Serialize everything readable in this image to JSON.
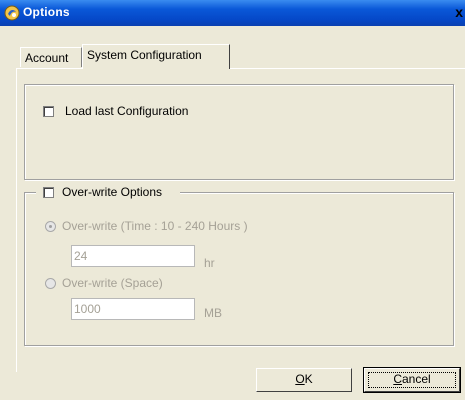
{
  "window": {
    "title": "Options",
    "close_label": "x"
  },
  "tabs": [
    {
      "label": "Account",
      "active": false
    },
    {
      "label": "System Configuration",
      "active": true
    }
  ],
  "load_last": {
    "label": "Load last Configuration",
    "checked": false
  },
  "overwrite": {
    "group_label": "Over-write Options",
    "checked": false,
    "time_option": {
      "label": "Over-write (Time : 10 - 240 Hours )",
      "selected": true,
      "value": "24",
      "unit": "hr"
    },
    "space_option": {
      "label": "Over-write (Space)",
      "selected": false,
      "value": "1000",
      "unit": "MB"
    }
  },
  "buttons": {
    "ok_accel": "O",
    "ok_rest": "K",
    "cancel_accel": "C",
    "cancel_rest": "ancel"
  }
}
